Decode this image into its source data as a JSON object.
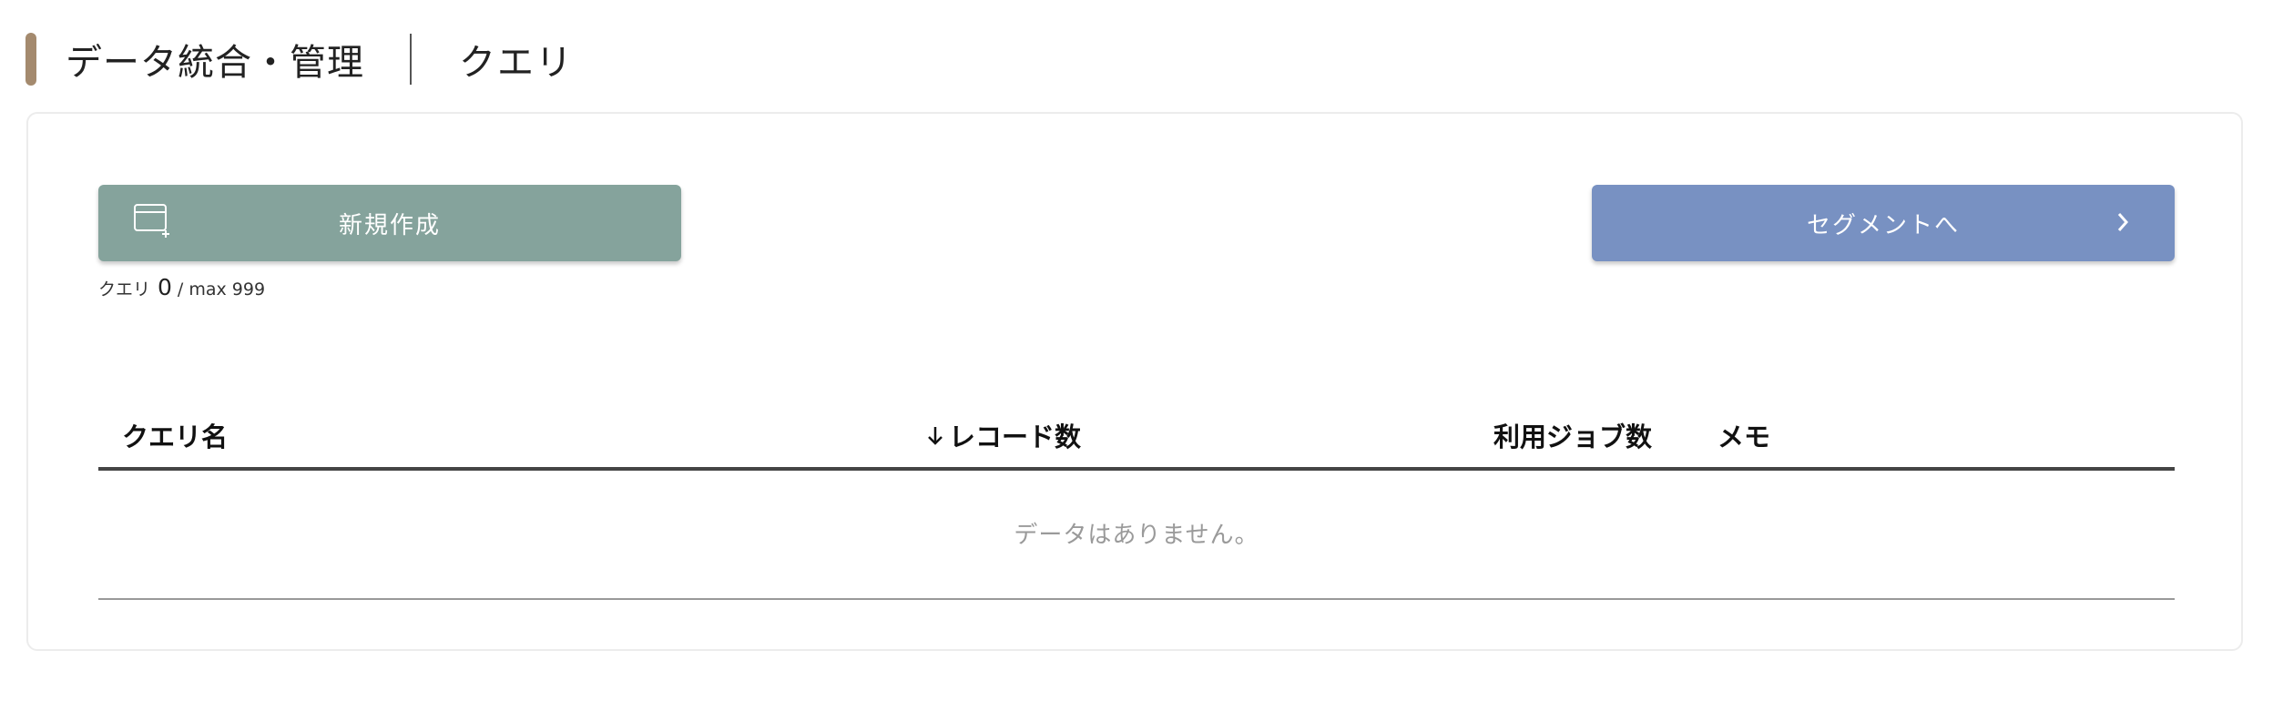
{
  "header": {
    "title": "データ統合・管理",
    "subtitle": "クエリ"
  },
  "toolbar": {
    "create_label": "新規作成",
    "create_icon": "new-window-plus-icon",
    "segment_label": "セグメントへ",
    "segment_icon": "chevron-right-icon"
  },
  "counter": {
    "label": "クエリ",
    "count": "0",
    "max": "/ max 999"
  },
  "table": {
    "columns": {
      "name": "クエリ名",
      "records": "レコード数",
      "jobs": "利用ジョブ数",
      "memo": "メモ"
    },
    "sort_icon": "arrow-down-icon",
    "empty_message": "データはありません。"
  },
  "colors": {
    "accent": "#a48a6e",
    "create_button": "#85a39c",
    "segment_button": "#7891c2",
    "table_header_border": "#444444"
  }
}
